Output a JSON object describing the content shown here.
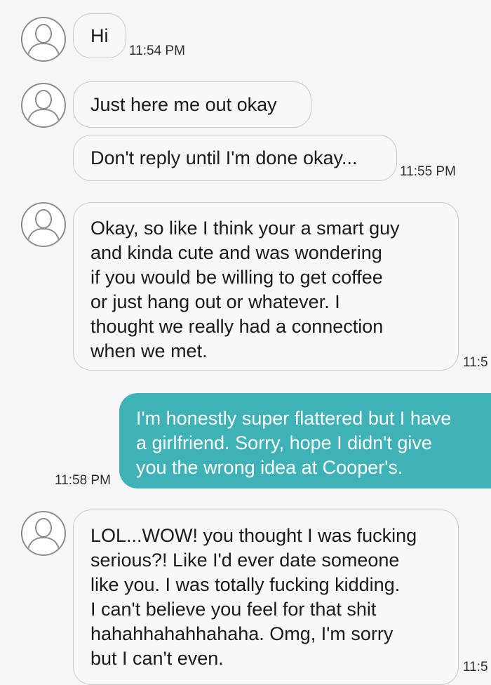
{
  "messages": [
    {
      "direction": "incoming",
      "text": "Hi",
      "time": "11:54 PM"
    },
    {
      "direction": "incoming",
      "text": "Just here me out okay",
      "time": ""
    },
    {
      "direction": "incoming",
      "text": "Don't reply until I'm done okay...",
      "time": "11:55 PM"
    },
    {
      "direction": "incoming",
      "text": "Okay, so like I think your a smart guy\nand kinda cute and was wondering\nif you would be willing to get coffee\nor just hang out or whatever. I\nthought we really had a connection\nwhen we met.",
      "time": "11:5"
    },
    {
      "direction": "outgoing",
      "text": "I'm honestly super flattered but I have\na girlfriend. Sorry, hope I didn't give\nyou the wrong idea at Cooper's.",
      "time": "11:58 PM"
    },
    {
      "direction": "incoming",
      "text": "LOL...WOW! you thought I was fucking\nserious?! Like I'd ever date someone\nlike you. I was totally fucking kidding.\nI can't believe you feel for that shit\nhahahhahahhahaha. Omg, I'm sorry\nbut I can't even.",
      "time": "11:5"
    }
  ],
  "icons": {
    "contact_avatar": "person-outline-icon"
  },
  "colors": {
    "background": "#f6f6f6",
    "incoming_bubble": "#f8f8f8",
    "incoming_border": "#c9c9c9",
    "outgoing_bubble": "#3fb2b7",
    "avatar_outline": "#8d8d8d"
  }
}
